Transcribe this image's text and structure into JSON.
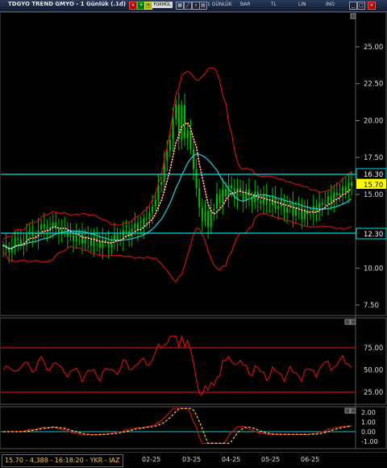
{
  "toolbar": {
    "title": "TDGYO TREND GMYO - 1 Günlük (.1d)",
    "formula_label": "FORMÜL",
    "period": "1 GÜNLÜK",
    "bar": "BAR",
    "tl": "TL",
    "lin": "LIN",
    "ino": "INO"
  },
  "price_axis": {
    "ticks": [
      "25.00",
      "22.50",
      "20.00",
      "17.50",
      "15.00",
      "12.50",
      "10.00",
      "7.50"
    ]
  },
  "levels": {
    "upper": "16.30",
    "last": "15.70",
    "lower": "12.30",
    "line_color": "#00e0e0",
    "last_bg": "#ffff00"
  },
  "rsi_axis": {
    "ticks": [
      "75.00",
      "50.00",
      "25.00"
    ]
  },
  "macd_axis": {
    "ticks": [
      "2.00",
      "1.00",
      "0.00",
      "-1.00"
    ]
  },
  "x_axis": {
    "labels": [
      "02-25",
      "03-25",
      "04-25",
      "05-25",
      "06-25"
    ]
  },
  "status": "15.70 - 4,388 - 16:18:20 - YKR - IAZ",
  "colors": {
    "candles": "#00c000",
    "bands": "#d01010",
    "ma_short": "#ffffff",
    "ma_long": "#20c0d0",
    "rsi": "#d01010",
    "macd_fast": "#d01010",
    "macd_signal": "#ffcc33"
  }
}
